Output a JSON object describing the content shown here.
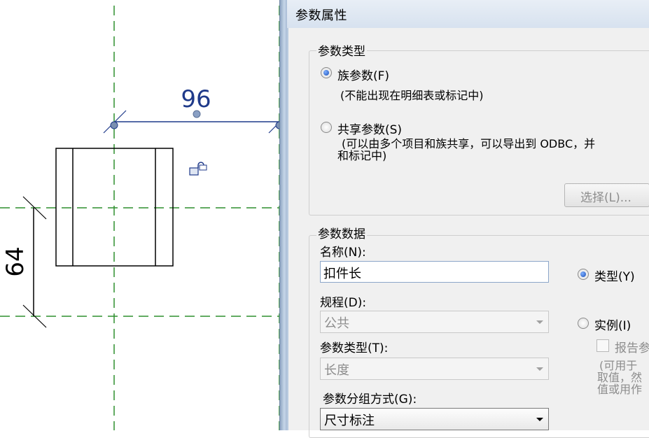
{
  "canvas": {
    "dimension_horizontal": "96",
    "dimension_vertical": "64"
  },
  "dialog": {
    "title": "参数属性",
    "parameter_type_group": {
      "legend": "参数类型",
      "family_param_label": "族参数(F)",
      "family_param_hint": "(不能出现在明细表或标记中)",
      "shared_param_label": "共享参数(S)",
      "shared_param_hint_line1": "(可以由多个项目和族共享，可以导出到 ODBC，并",
      "shared_param_hint_line2": "和标记中)",
      "select_button": "选择(L)...",
      "selected": "family"
    },
    "parameter_data_group": {
      "legend": "参数数据",
      "name_label": "名称(N):",
      "name_value": "扣件长",
      "discipline_label": "规程(D):",
      "discipline_value": "公共",
      "param_type_label": "参数类型(T):",
      "param_type_value": "长度",
      "grouping_label": "参数分组方式(G):",
      "grouping_value": "尺寸标注",
      "type_radio_label": "类型(Y)",
      "instance_radio_label": "实例(I)",
      "instance_selected": false,
      "report_checkbox_label": "报告参",
      "report_hint_line1": "(可用于",
      "report_hint_line2": "取值，然",
      "report_hint_line3": "值或用作"
    }
  }
}
